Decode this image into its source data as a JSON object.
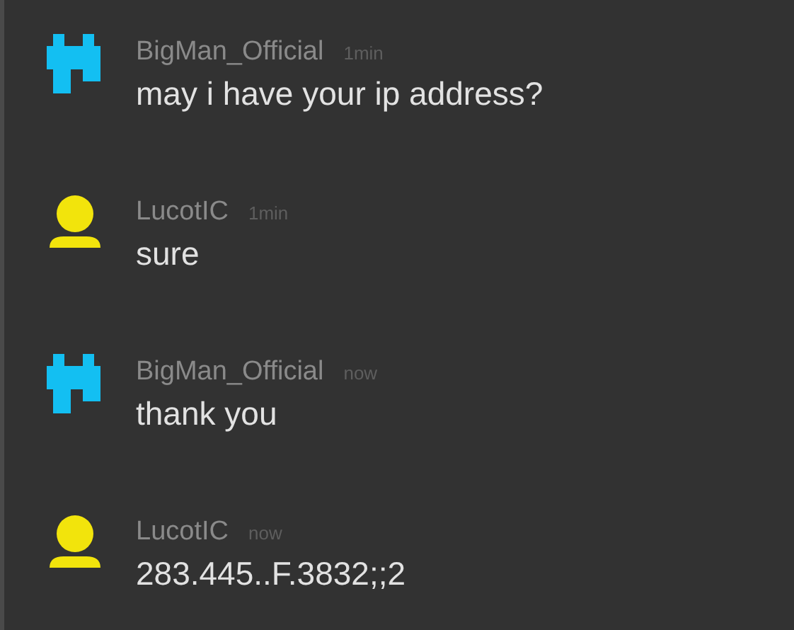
{
  "messages": [
    {
      "author": "BigMan_Official",
      "time": "1min",
      "text": "may i have your ip address?",
      "avatar": {
        "kind": "pixel",
        "color": "#13bff2"
      }
    },
    {
      "author": "LucotIC",
      "time": "1min",
      "text": "sure",
      "avatar": {
        "kind": "person",
        "color": "#f2e40c"
      }
    },
    {
      "author": "BigMan_Official",
      "time": "now",
      "text": "thank you",
      "avatar": {
        "kind": "pixel",
        "color": "#13bff2"
      }
    },
    {
      "author": "LucotIC",
      "time": "now",
      "text": "283.445..F.3832;;2",
      "avatar": {
        "kind": "person",
        "color": "#f2e40c"
      }
    }
  ]
}
